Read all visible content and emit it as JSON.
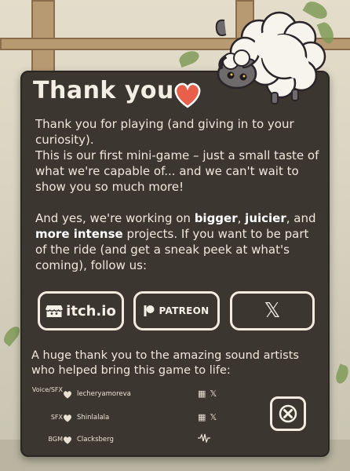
{
  "dialog": {
    "title": "Thank you",
    "paragraph1": "Thank you for playing (and giving in to your curiosity).",
    "paragraph2": "This is our first mini-game – just a small taste of what we're capable of... and we can't wait to show you so much more!",
    "p3_part1": "And yes, we're working on ",
    "p3_bold1": "bigger",
    "p3_sep1": ", ",
    "p3_bold2": "juicier",
    "p3_part2": ", and ",
    "p3_bold3": "more intense",
    "p3_part3": " projects. If you want to be part of the ride (and get a sneak peek at what's coming), follow us:",
    "links": {
      "itch_label": "itch.io",
      "patreon_label": "PATREON",
      "x_label": "𝕏"
    },
    "thanks_text": "A huge thank you to the amazing sound artists who helped bring this game to life:",
    "credits": [
      {
        "role": "Voice/SFX",
        "name": "lecheryamoreva",
        "icons": [
          "itch-icon",
          "x-icon"
        ]
      },
      {
        "role": "SFX",
        "name": "Shinlalala",
        "icons": [
          "itch-icon",
          "x-icon"
        ]
      },
      {
        "role": "BGM",
        "name": "Clacksberg",
        "icons": [
          "waveform-icon"
        ]
      }
    ],
    "close_icon": "close-x-icon",
    "accent_color": "#e8604c",
    "panel_color": "#3b3630"
  }
}
